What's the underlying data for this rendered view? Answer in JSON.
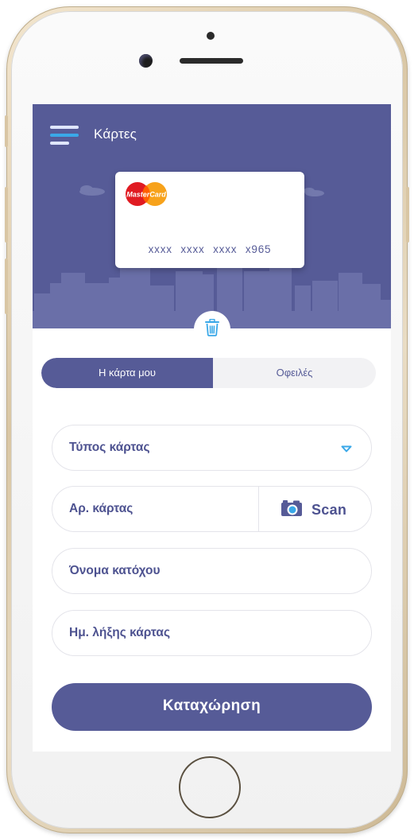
{
  "header": {
    "title": "Κάρτες",
    "menu_icon": "hamburger-menu-icon"
  },
  "card": {
    "brand": "MasterCard",
    "number": "xxxx xxxx xxxx x965"
  },
  "delete_icon": "trash-icon",
  "tabs": [
    {
      "label": "Η κάρτα μου",
      "active": true
    },
    {
      "label": "Οφειλές",
      "active": false
    }
  ],
  "form": {
    "card_type": {
      "label": "Τύπος κάρτας",
      "icon": "chevron-down-icon"
    },
    "card_number": {
      "label": "Αρ. κάρτας"
    },
    "scan": {
      "label": "Scan",
      "icon": "camera-icon"
    },
    "holder_name": {
      "label": "Όνομα κατόχου"
    },
    "expiry": {
      "label": "Ημ. λήξης κάρτας"
    },
    "submit_label": "Καταχώρηση"
  },
  "colors": {
    "primary": "#565b97",
    "accent": "#3aa8e8",
    "field_border": "#e4e4ea"
  }
}
